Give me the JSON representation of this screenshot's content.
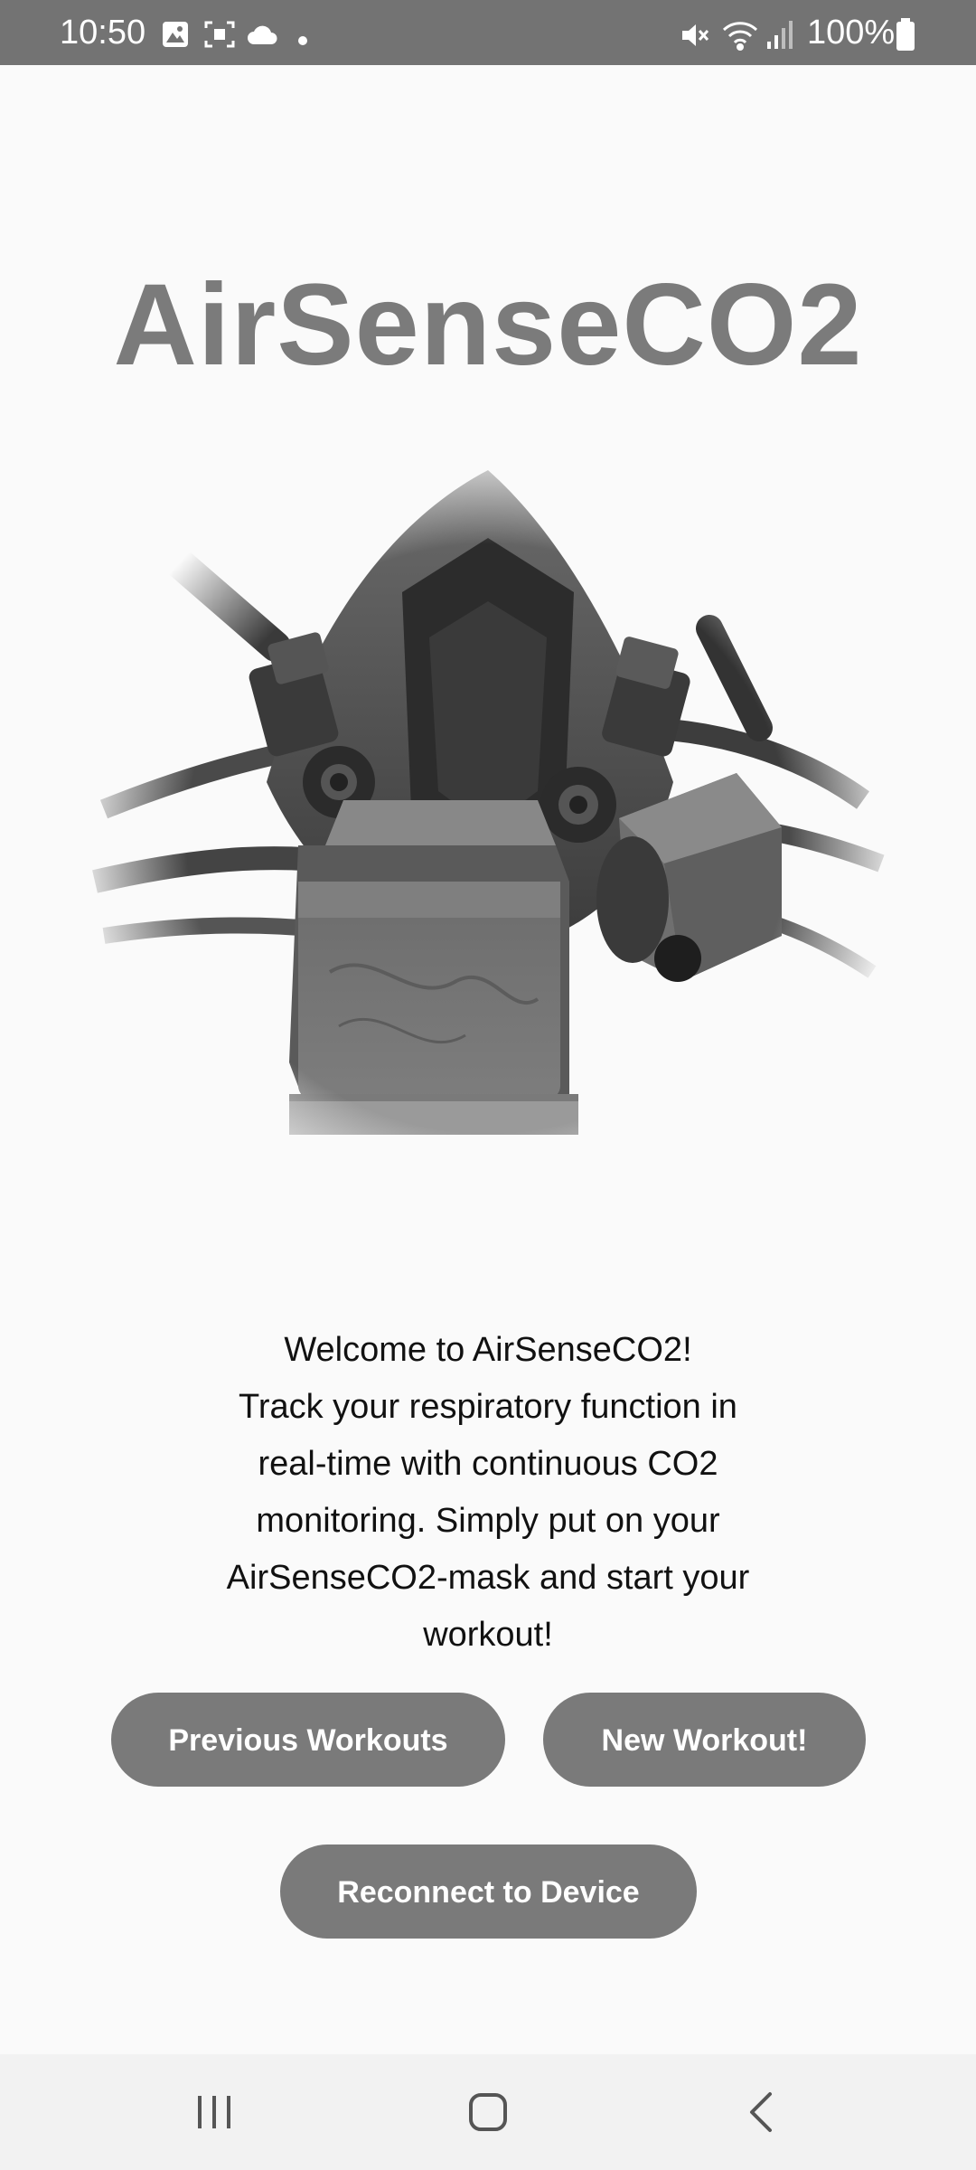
{
  "status_bar": {
    "time": "10:50",
    "battery": "100%",
    "left_icons": [
      "gallery-icon",
      "screenshot-icon",
      "cloud-icon",
      "dot-icon"
    ],
    "right_icons": [
      "mute-icon",
      "wifi-icon",
      "signal-icon",
      "battery-icon"
    ]
  },
  "app": {
    "title": "AirSenseCO2"
  },
  "welcome": {
    "lines": [
      "Welcome to AirSenseCO2!",
      "Track your respiratory function in",
      "real-time with continuous CO2",
      "monitoring. Simply put on your",
      "AirSenseCO2-mask and start your",
      "workout!"
    ]
  },
  "buttons": {
    "previous_workouts": "Previous Workouts",
    "new_workout": "New Workout!",
    "reconnect": "Reconnect to Device"
  },
  "nav_bar": {
    "icons": [
      "recent-apps-icon",
      "home-icon",
      "back-icon"
    ]
  },
  "colors": {
    "status_bar": "#737373",
    "title": "#7b7b7b",
    "button": "#7a7a7a",
    "background": "#fafafa"
  }
}
